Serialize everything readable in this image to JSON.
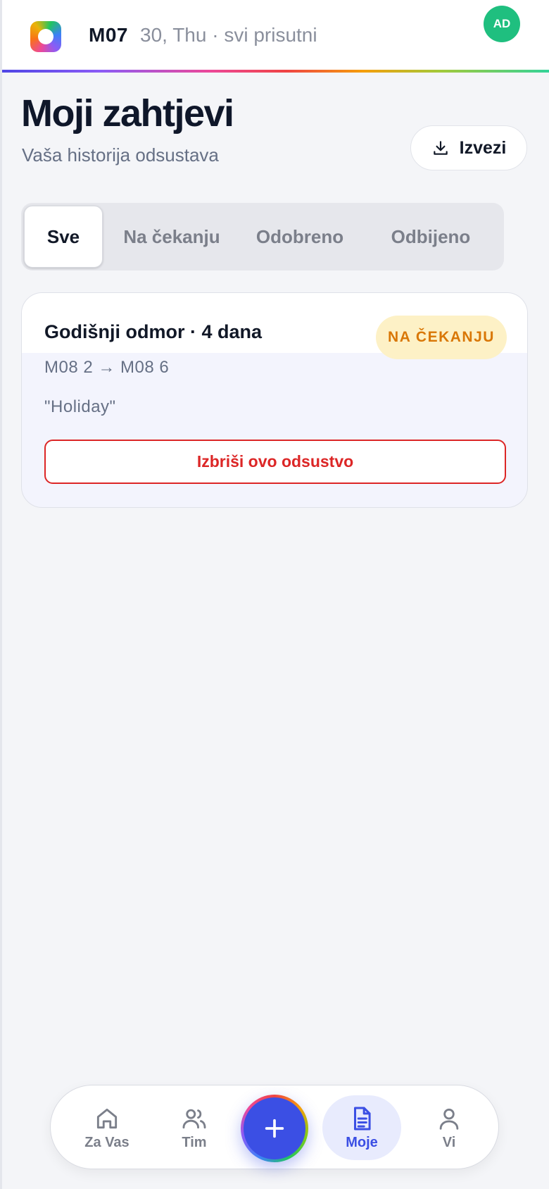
{
  "header": {
    "month": "M07",
    "subtitle": "30, Thu · svi prisutni",
    "avatar_initials": "AD"
  },
  "page": {
    "title": "Moji zahtjevi",
    "subtitle": "Vaša historija odsustava",
    "export_label": "Izvezi"
  },
  "tabs": [
    {
      "label": "Sve",
      "active": true
    },
    {
      "label": "Na čekanju",
      "active": false
    },
    {
      "label": "Odobreno",
      "active": false
    },
    {
      "label": "Odbijeno",
      "active": false
    }
  ],
  "requests": [
    {
      "title": "Godišnji odmor · 4 dana",
      "status": "NA ČEKANJU",
      "dates": "M08 2 → M08 6",
      "note": "\"Holiday\"",
      "delete_label": "Izbriši ovo odsustvo"
    }
  ],
  "nav": {
    "items": [
      {
        "label": "Za Vas",
        "icon": "home-icon"
      },
      {
        "label": "Tim",
        "icon": "users-icon"
      },
      {
        "label": "Moje",
        "icon": "document-icon",
        "active": true
      },
      {
        "label": "Vi",
        "icon": "user-icon"
      }
    ],
    "fab_icon": "plus-icon"
  },
  "colors": {
    "accent": "#3b4fe4",
    "avatar": "#1fbf7f",
    "pending_badge_bg": "#fdf1c6",
    "pending_badge_text": "#d97706",
    "danger": "#dc2626"
  }
}
